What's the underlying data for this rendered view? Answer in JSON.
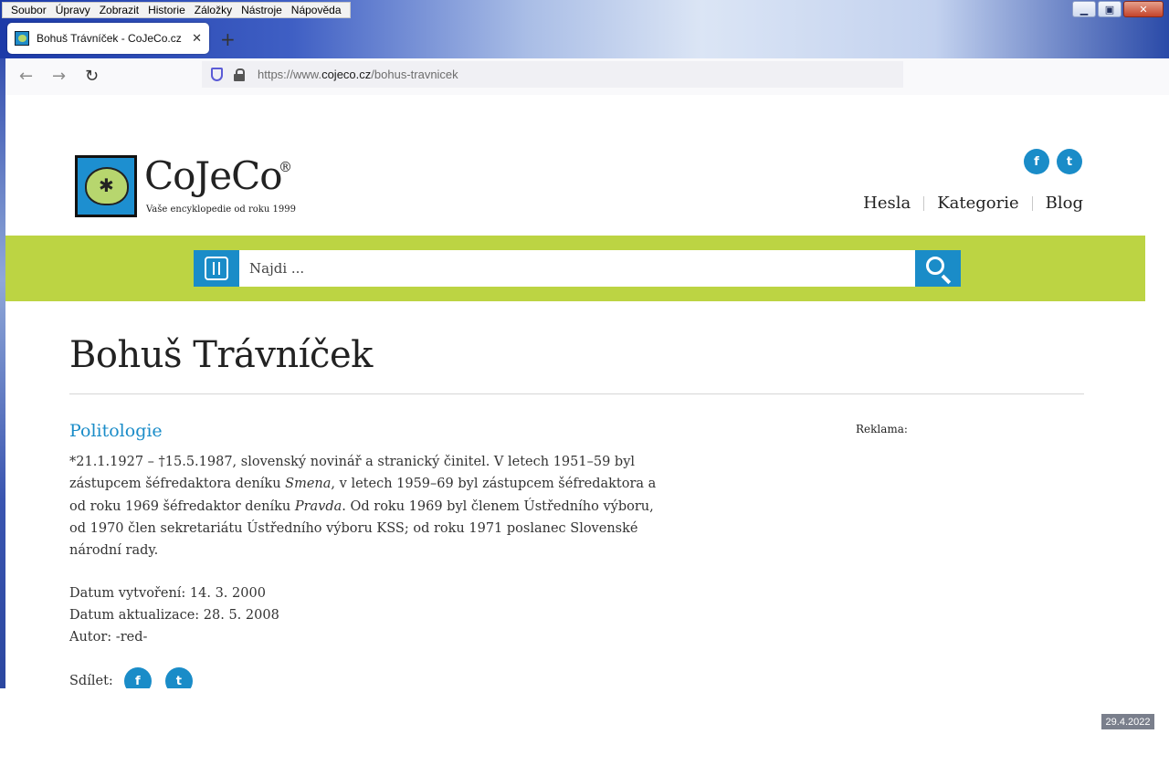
{
  "menubar": {
    "items": [
      "Soubor",
      "Úpravy",
      "Zobrazit",
      "Historie",
      "Záložky",
      "Nástroje",
      "Nápověda"
    ]
  },
  "window_controls": {
    "minimize": "▁",
    "maximize": "▣",
    "close": "✕"
  },
  "tab": {
    "title": "Bohuš Trávníček - CoJeCo.cz",
    "close": "✕",
    "new_tab": "+"
  },
  "toolbar": {
    "back": "←",
    "forward": "→",
    "reload": "↻",
    "url_prefix": "https://www.",
    "url_domain": "cojeco.cz",
    "url_path": "/bohus-travnicek"
  },
  "site": {
    "logo_name": "CoJeCo",
    "logo_reg": "®",
    "tagline": "Vaše encyklopedie od roku 1999",
    "social": {
      "facebook": "f",
      "twitter": "t"
    },
    "nav": [
      "Hesla",
      "Kategorie",
      "Blog"
    ]
  },
  "search": {
    "placeholder": "Najdi ..."
  },
  "article": {
    "title": "Bohuš Trávníček",
    "category": "Politologie",
    "body": {
      "p1": "*21.1.1927 – †15.5.1987, slovenský novinář a stranický činitel. V letech 1951–59 byl zástupcem šéfredaktora deníku ",
      "em1": "Smena",
      "p2": ", v letech 1959–69 byl zástupcem šéfredaktora a od roku 1969 šéfredaktor deníku ",
      "em2": "Pravda",
      "p3": ". Od roku 1969 byl členem Ústředního výboru, od 1970 člen sekretariátu Ústředního výboru KSS; od roku 1971 poslanec Slovenské národní rady."
    },
    "meta": {
      "created": "Datum vytvoření: 14. 3. 2000",
      "updated": "Datum aktualizace: 28. 5. 2008",
      "author": "Autor: -red-"
    },
    "share_label": "Sdílet:",
    "ad_label": "Reklama:"
  },
  "date_stamp": "29.4.2022",
  "colors": {
    "brand_blue": "#1a8cc8",
    "brand_green": "#bcd443",
    "text": "#333333"
  }
}
